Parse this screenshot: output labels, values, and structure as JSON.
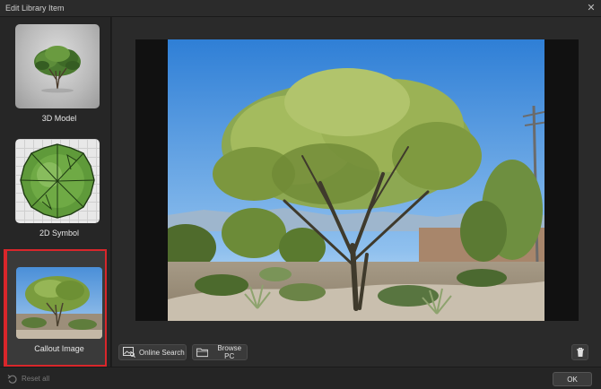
{
  "window": {
    "title": "Edit Library Item",
    "close_glyph": "✕"
  },
  "sidebar": {
    "items": [
      {
        "label": "3D Model",
        "icon": "tree-model-icon"
      },
      {
        "label": "2D Symbol",
        "icon": "tree-symbol-icon"
      },
      {
        "label": "Callout Image",
        "icon": "callout-image-thumbnail",
        "selected": true
      }
    ],
    "selected_color": "#d9262b"
  },
  "toolbar": {
    "online_search_label": "Online Search",
    "browse_pc_label": "Browse PC"
  },
  "footer": {
    "reset_all_label": "Reset all",
    "ok_label": "OK"
  }
}
